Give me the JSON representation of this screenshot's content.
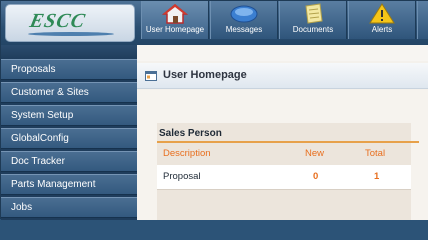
{
  "app": {
    "logo_text": "ESCC"
  },
  "nav": {
    "items": [
      {
        "label": "User Homepage",
        "icon": "house-icon",
        "active": true
      },
      {
        "label": "Messages",
        "icon": "messages-icon",
        "active": false
      },
      {
        "label": "Documents",
        "icon": "document-icon",
        "active": false
      },
      {
        "label": "Alerts",
        "icon": "alert-icon",
        "active": false
      }
    ]
  },
  "sidebar": {
    "items": [
      {
        "label": "Proposals"
      },
      {
        "label": "Customer & Sites"
      },
      {
        "label": "System Setup"
      },
      {
        "label": "GlobalConfig"
      },
      {
        "label": "Doc Tracker"
      },
      {
        "label": "Parts Management"
      },
      {
        "label": "Jobs"
      }
    ]
  },
  "page": {
    "title": "User Homepage"
  },
  "sales_person": {
    "title": "Sales Person",
    "headers": {
      "description": "Description",
      "new": "New",
      "total": "Total"
    },
    "rows": [
      {
        "description": "Proposal",
        "new": "0",
        "total": "1"
      }
    ]
  },
  "colors": {
    "accent_orange": "#e86f1f",
    "rule_orange": "#e7a14a",
    "nav_blue": "#2f557b",
    "sidebar_blue": "#3a5f84"
  }
}
